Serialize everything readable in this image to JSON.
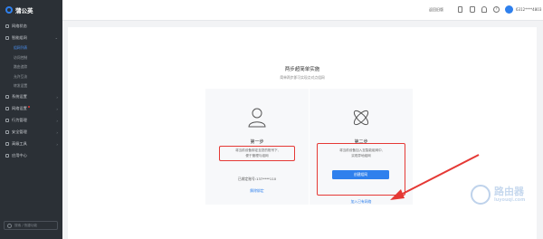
{
  "sidebar": {
    "brand": "蒲公英",
    "items": [
      {
        "label": "网络状态",
        "icon": "dashboard-icon",
        "chevron": ""
      },
      {
        "label": "智能组网",
        "icon": "network-icon",
        "chevron": "⌄"
      },
      {
        "label": "系统设置",
        "icon": "settings-icon",
        "chevron": "›"
      },
      {
        "label": "网络设置",
        "icon": "globe-icon",
        "chevron": "›",
        "badge": true
      },
      {
        "label": "行为管理",
        "icon": "behavior-icon",
        "chevron": "›"
      },
      {
        "label": "安全管理",
        "icon": "shield-icon",
        "chevron": "›"
      },
      {
        "label": "高级工具",
        "icon": "tools-icon",
        "chevron": "›"
      },
      {
        "label": "应用中心",
        "icon": "apps-icon",
        "chevron": ""
      }
    ],
    "subitems": [
      {
        "label": "组网列表",
        "active": true
      },
      {
        "label": "访问控制",
        "active": false
      },
      {
        "label": "路由追踪",
        "active": false
      },
      {
        "label": "允许互访",
        "active": false
      },
      {
        "label": "转发设置",
        "active": false
      }
    ],
    "search_placeholder": "搜索 / 快捷功能"
  },
  "topbar": {
    "return_label": "返回旧版",
    "user_name": "6312****4803",
    "caret": "⌄",
    "help_glyph": "?"
  },
  "main": {
    "title": "两步超简单实施",
    "subtitle": "简单两步即可实现点对点组网",
    "step1": {
      "title": "第一步",
      "desc_line1": "将当前设备绑定至您的账号下,",
      "desc_line2": "便于管理与组网",
      "bound": "已绑定账号:137****110",
      "link": "解除绑定"
    },
    "step2": {
      "title": "第二步",
      "desc_line1": "将当前设备加入至智能组网中,",
      "desc_line2": "实现异地组网",
      "button": "创建组网",
      "link": "加入已有网络"
    }
  },
  "watermark": {
    "big": "路由器",
    "small": "luyouqi.com"
  },
  "colors": {
    "accent": "#2f80ed",
    "highlight": "#e53935",
    "sidebar_bg": "#2b3036"
  }
}
